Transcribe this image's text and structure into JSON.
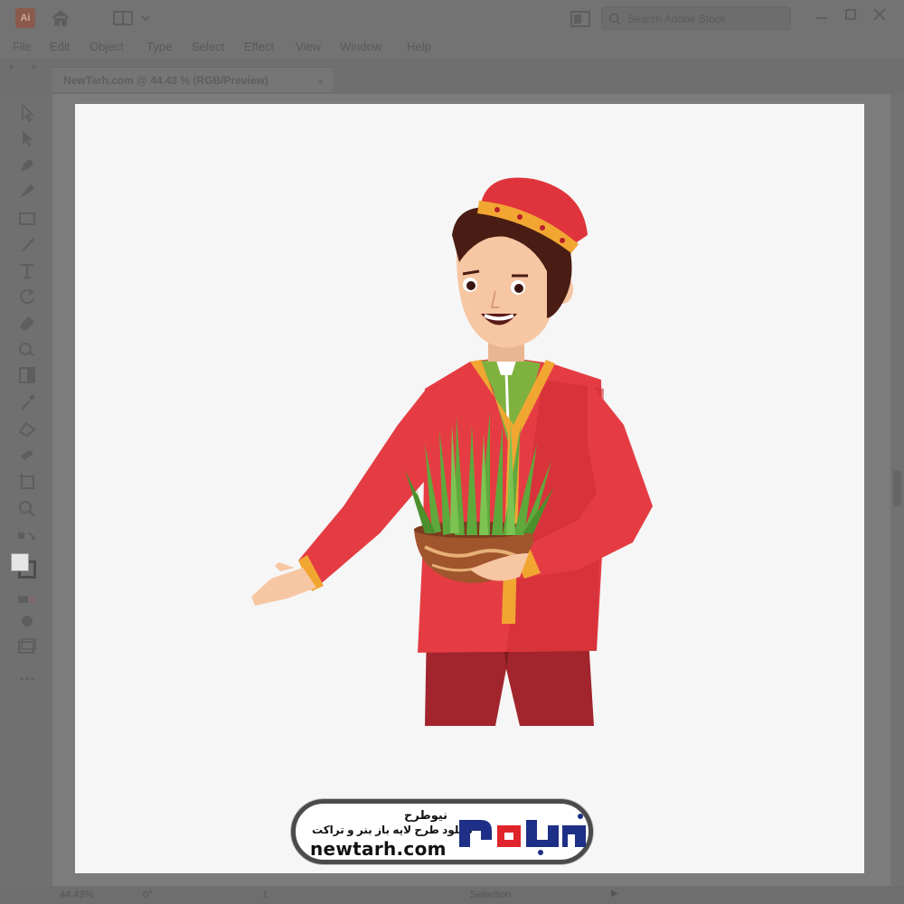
{
  "app": {
    "logo_text": "Ai",
    "search_placeholder": "Search Adobe Stock"
  },
  "menu": [
    "File",
    "Edit",
    "Object",
    "Type",
    "Select",
    "Effect",
    "View",
    "Window",
    "Help"
  ],
  "document_tab": {
    "title": "NewTarh.com @ 44.43 % (RGB/Preview)",
    "close": "×"
  },
  "status": {
    "zoom": "44.43%",
    "rotation": "0°",
    "page": "1",
    "tool": "Selection",
    "play": "▶"
  },
  "watermark": {
    "name": "نیوطرح",
    "tagline": "دانلود طرح لایه باز بنر و تراکت",
    "domain": "newtarh.com",
    "logo_text": "نیوطرح",
    "colors": {
      "blue": "#1d2f86",
      "red": "#e0242b"
    }
  },
  "icons": {
    "toolbar": [
      "selection-tool-icon",
      "direct-selection-tool-icon",
      "pen-tool-icon",
      "curvature-tool-icon",
      "rectangle-tool-icon",
      "paintbrush-tool-icon",
      "type-tool-icon",
      "rotate-tool-icon",
      "eraser-tool-icon",
      "shape-builder-tool-icon",
      "gradient-tool-icon",
      "eyedropper-tool-icon",
      "blend-tool-icon",
      "symbol-sprayer-tool-icon",
      "artboard-tool-icon",
      "zoom-tool-icon"
    ]
  },
  "colors": {
    "chrome": "#737373",
    "artboard": "#f6f6f6",
    "jacket": "#e53c43",
    "hat": "#e0343c",
    "trim": "#f2a632",
    "grass": "#5fa83c",
    "pants": "#a2242c",
    "hair": "#4a1d14",
    "skin": "#f7c6a3"
  }
}
